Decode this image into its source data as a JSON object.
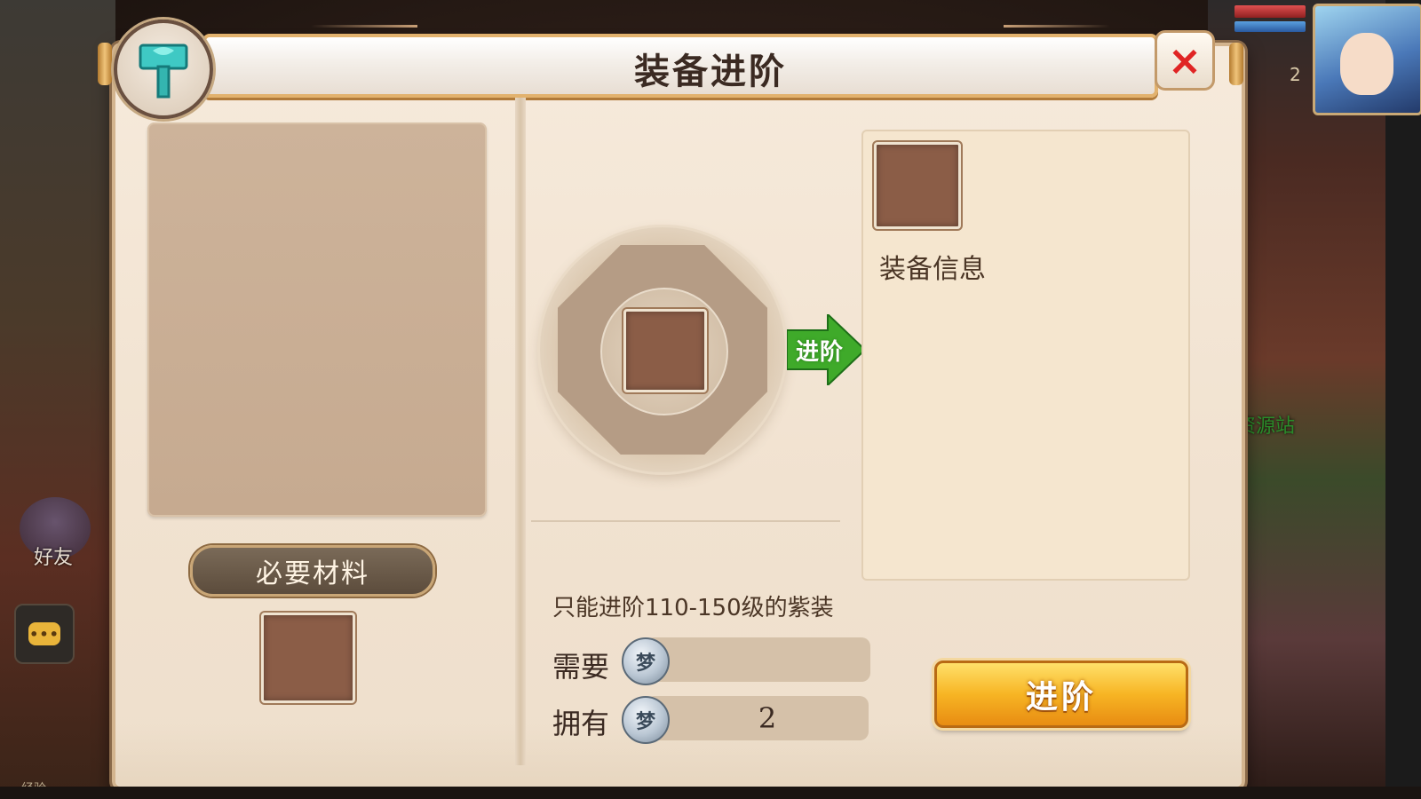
{
  "dialog": {
    "title": "装备进阶",
    "close_icon": "×"
  },
  "left": {
    "materials_label": "必要材料"
  },
  "middle": {
    "arrow_label": "进阶",
    "hint": "只能进阶110-150级的紫装",
    "need_label": "需要",
    "have_label": "拥有",
    "have_value": "2",
    "coin_glyph": "梦"
  },
  "right": {
    "info_label": "装备信息",
    "advance_button": "进阶"
  },
  "background": {
    "friend_label": "好友",
    "resource_station": "资源站",
    "exp_label": "经验",
    "level_fragment": "2",
    "chat_icon": "•••"
  },
  "colors": {
    "advance_button": "#f7b524",
    "arrow_green": "#3faa2a",
    "close_red": "#e02424",
    "slot_brown": "#8b5d47"
  }
}
